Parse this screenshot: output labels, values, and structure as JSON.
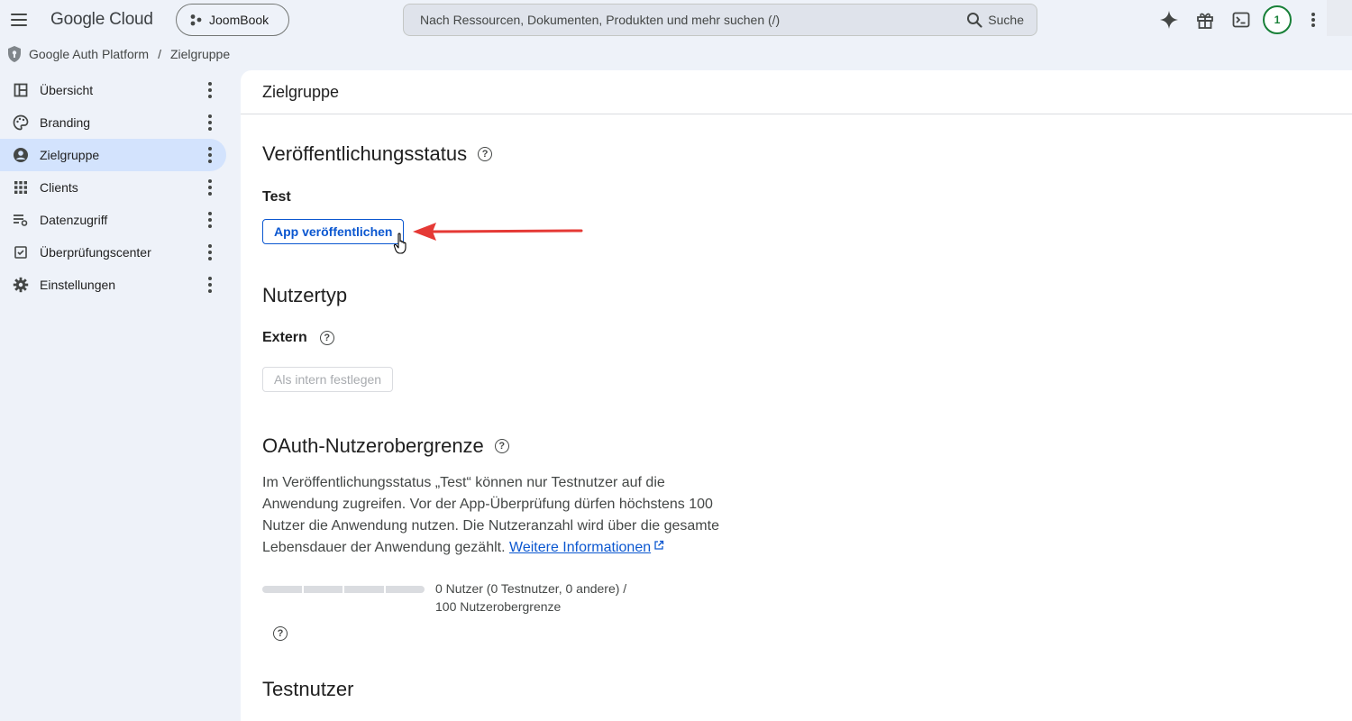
{
  "header": {
    "logo": "Google Cloud",
    "project": "JoomBook",
    "search_placeholder": "Nach Ressourcen, Dokumenten, Produkten und mehr suchen (/)",
    "search_button": "Suche",
    "avatar_badge": "1"
  },
  "breadcrumb": {
    "root": "Google Auth Platform",
    "separator": "/",
    "current": "Zielgruppe"
  },
  "sidebar": {
    "items": [
      {
        "label": "Übersicht",
        "icon": "dashboard-icon"
      },
      {
        "label": "Branding",
        "icon": "palette-icon"
      },
      {
        "label": "Zielgruppe",
        "icon": "person-circle-icon",
        "active": true
      },
      {
        "label": "Clients",
        "icon": "grid-icon"
      },
      {
        "label": "Datenzugriff",
        "icon": "data-access-icon"
      },
      {
        "label": "Überprüfungscenter",
        "icon": "verified-checkbox-icon"
      },
      {
        "label": "Einstellungen",
        "icon": "gear-icon"
      }
    ]
  },
  "main": {
    "page_title": "Zielgruppe",
    "publishing": {
      "heading": "Veröffentlichungsstatus",
      "status": "Test",
      "button": "App veröffentlichen"
    },
    "user_type": {
      "heading": "Nutzertyp",
      "value": "Extern",
      "button": "Als intern festlegen"
    },
    "oauth_cap": {
      "heading": "OAuth-Nutzerobergrenze",
      "description": "Im Veröffentlichungsstatus „Test“ können nur Testnutzer auf die Anwendung zugreifen. Vor der App-Überprüfung dürfen höchstens 100 Nutzer die Anwendung nutzen. Die Nutzeranzahl wird über die gesamte Lebensdauer der Anwendung gezählt.",
      "link": "Weitere Informationen",
      "usage_line1": "0 Nutzer (0 Testnutzer, 0 andere) /",
      "usage_line2": "100 Nutzerobergrenze",
      "usage_fraction": 0
    },
    "test_users": {
      "heading": "Testnutzer"
    }
  },
  "colors": {
    "accent": "#0b57d0",
    "active_nav": "#d3e3fd",
    "annotation_arrow": "#e53935",
    "avatar_ring": "#188038"
  }
}
